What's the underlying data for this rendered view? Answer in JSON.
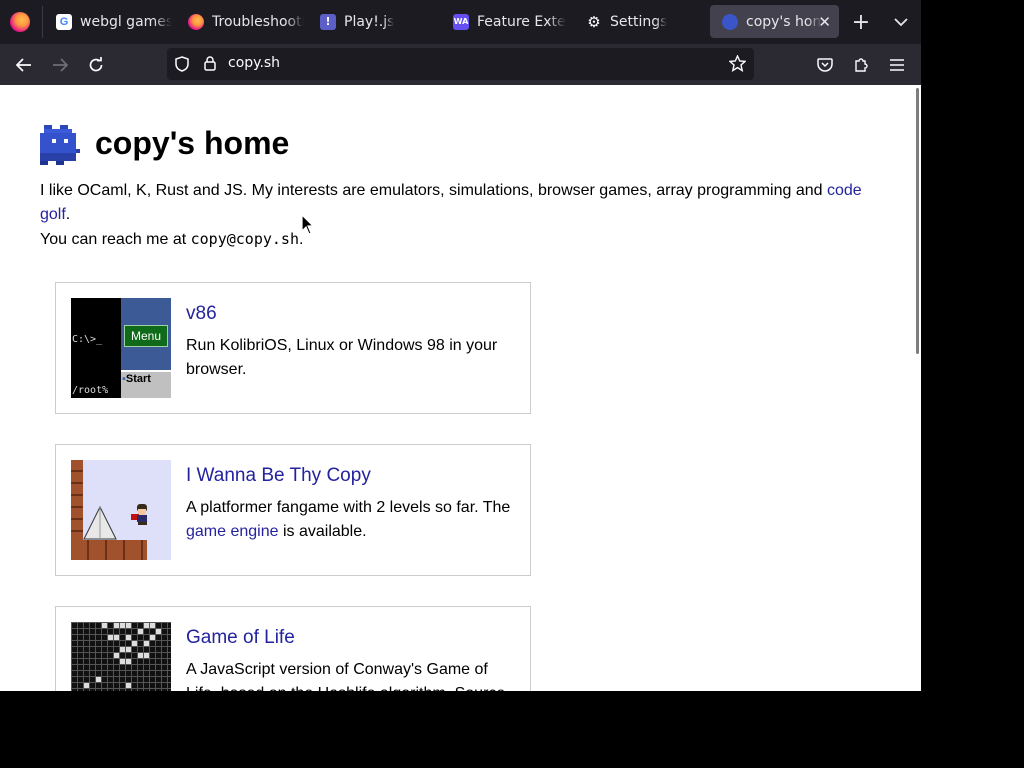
{
  "tabs": [
    {
      "label": "webgl games",
      "icon": "google-icon",
      "active": false
    },
    {
      "label": "Troubleshooti",
      "icon": "firefox-icon",
      "active": false
    },
    {
      "label": "Play!.js",
      "icon": "play-js-icon",
      "active": false
    },
    {
      "label": "Feature Exte",
      "icon": "webassembly-icon",
      "active": false
    },
    {
      "label": "Settings",
      "icon": "gear-icon",
      "active": false
    },
    {
      "label": "copy's hom",
      "icon": "copy-favicon-icon",
      "active": true
    }
  ],
  "toolbar": {
    "new_tab": "+",
    "list_tabs": "⌄",
    "close_tab": "✕"
  },
  "nav": {
    "url": "copy.sh"
  },
  "page": {
    "title": "copy's home",
    "intro_text": "I like OCaml, K, Rust and JS. My interests are emulators, simulations, browser games, array programming and ",
    "intro_link": "code golf",
    "intro_end": ".",
    "contact_text": "You can reach me at ",
    "contact_email": "copy@copy.sh",
    "contact_end": ".",
    "projects": [
      {
        "title": "v86",
        "desc": "Run KolibriOS, Linux or Windows 98 in your browser.",
        "thumb_prompt": "C:\\>_",
        "thumb_prompt2": "/root%",
        "thumb_menu": "Menu",
        "thumb_start": "Start"
      },
      {
        "title": "I Wanna Be Thy Copy",
        "desc_a": "A platformer fangame with 2 levels so far. The ",
        "desc_link": "game engine",
        "desc_b": " is available."
      },
      {
        "title": "Game of Life",
        "desc": "A JavaScript version of Conway's Game of Life, based on the Hashlife algorithm. Source"
      }
    ]
  },
  "colors": {
    "link": "#23239e",
    "tab_bar": "#1c1b22",
    "nav_bar": "#2b2a33",
    "active_tab": "#42414d"
  }
}
